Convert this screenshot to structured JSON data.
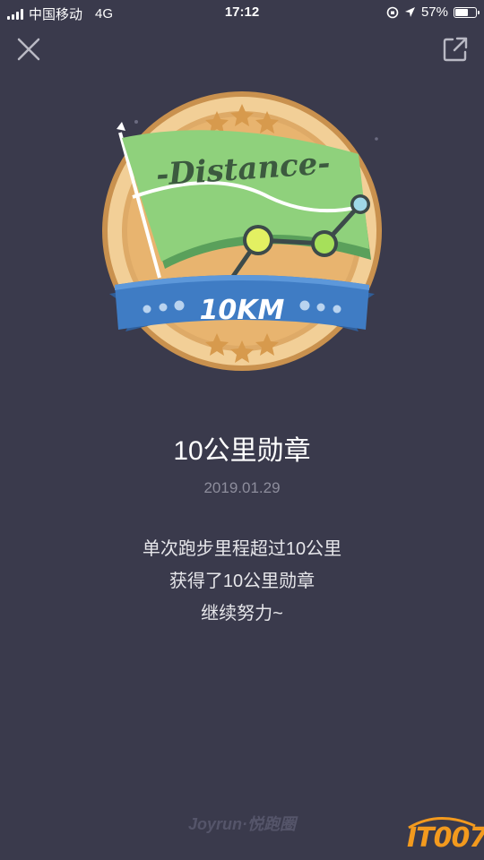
{
  "status_bar": {
    "carrier": "中国移动",
    "network": "4G",
    "time": "17:12",
    "battery": "57%",
    "battery_level": 0.57
  },
  "badge": {
    "banner_text": "-Distance-",
    "ribbon_text": "10KM"
  },
  "title": "10公里勋章",
  "date": "2019.01.29",
  "description": [
    "单次跑步里程超过10公里",
    "获得了10公里勋章",
    "继续努力~"
  ],
  "footer": {
    "brand": "Joyrun·悦跑圈"
  },
  "watermark": {
    "text": "IT007"
  },
  "colors": {
    "background": "#3a3a4c",
    "medal_gold": "#e8b46a",
    "flag_green": "#8fd17c",
    "ribbon_blue": "#3f7cc4",
    "watermark_orange": "#f39a1e"
  },
  "icons": {
    "close": "close-icon",
    "share": "share-icon"
  }
}
